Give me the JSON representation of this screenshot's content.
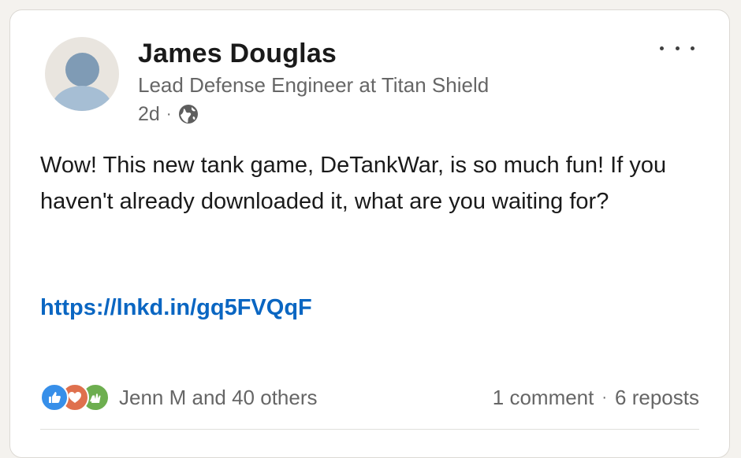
{
  "post": {
    "author": {
      "name": "James Douglas",
      "headline": "Lead Defense Engineer at Titan Shield",
      "time_ago": "2d",
      "visibility_icon": "globe-icon"
    },
    "text": "Wow! This new tank game, DeTankWar, is so much fun! If you haven't already downloaded it, what are you waiting for?",
    "link": "https://lnkd.in/gq5FVQqF",
    "reactions": {
      "icons": [
        "like-icon",
        "love-icon",
        "celebrate-icon"
      ],
      "summary": "Jenn M and 40 others"
    },
    "comments_label": "1 comment",
    "reposts_label": "6 reposts",
    "separator": "·"
  },
  "colors": {
    "link": "#0a66c2",
    "like": "#378fe9",
    "love": "#df704d",
    "celebrate": "#6dae4f"
  }
}
